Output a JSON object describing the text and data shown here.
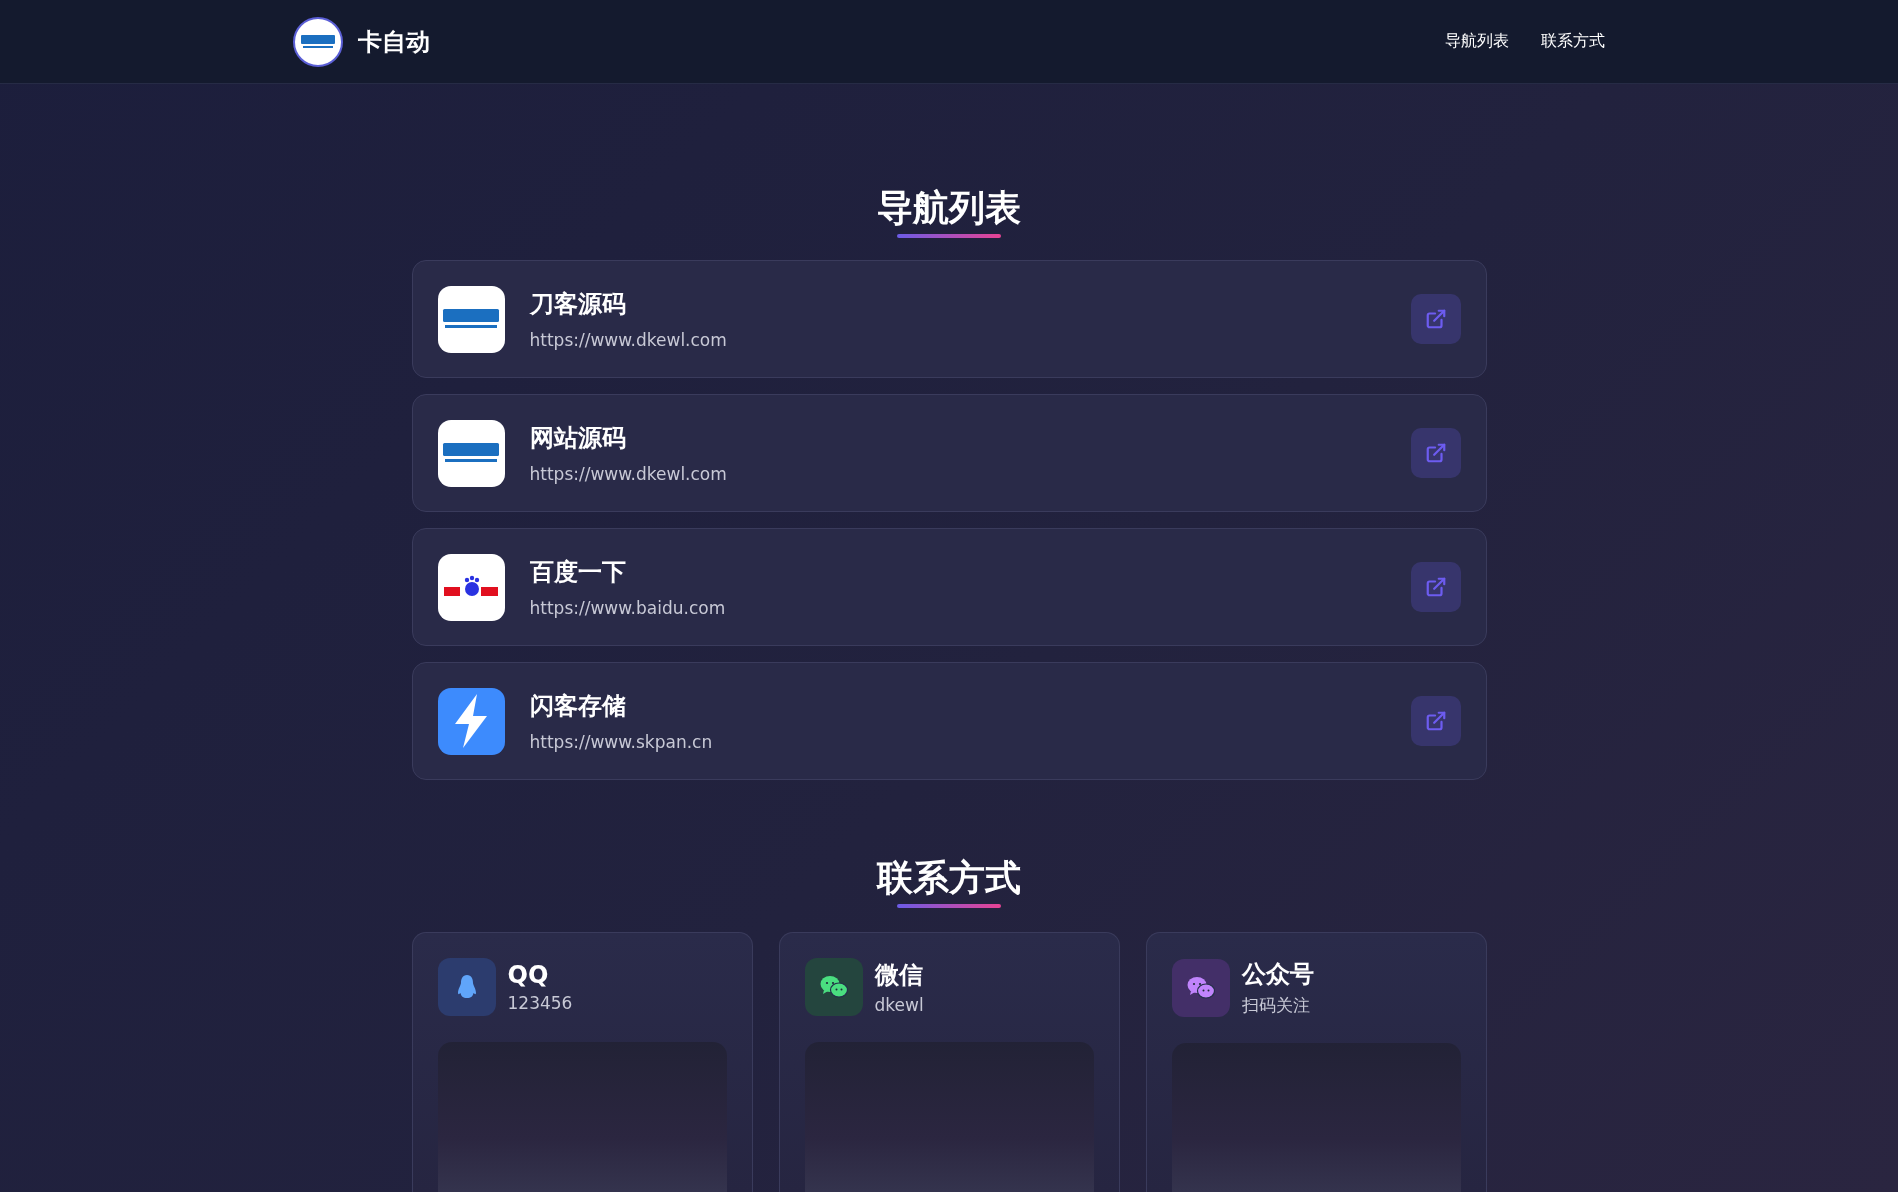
{
  "header": {
    "site_name": "卡自动",
    "nav": [
      {
        "label": "导航列表"
      },
      {
        "label": "联系方式"
      }
    ]
  },
  "nav_section": {
    "title": "导航列表",
    "links": [
      {
        "kind": "dk",
        "name": "刀客源码",
        "url": "https://www.dkewl.com"
      },
      {
        "kind": "dk",
        "name": "网站源码",
        "url": "https://www.dkewl.com"
      },
      {
        "kind": "baidu",
        "name": "百度一下",
        "url": "https://www.baidu.com"
      },
      {
        "kind": "bolt",
        "name": "闪客存储",
        "url": "https://www.skpan.cn"
      }
    ]
  },
  "contact_section": {
    "title": "联系方式",
    "contacts": [
      {
        "kind": "qq",
        "name": "QQ",
        "value": "123456"
      },
      {
        "kind": "wechat",
        "name": "微信",
        "value": "dkewl"
      },
      {
        "kind": "official",
        "name": "公众号",
        "value": "扫码关注"
      }
    ]
  }
}
